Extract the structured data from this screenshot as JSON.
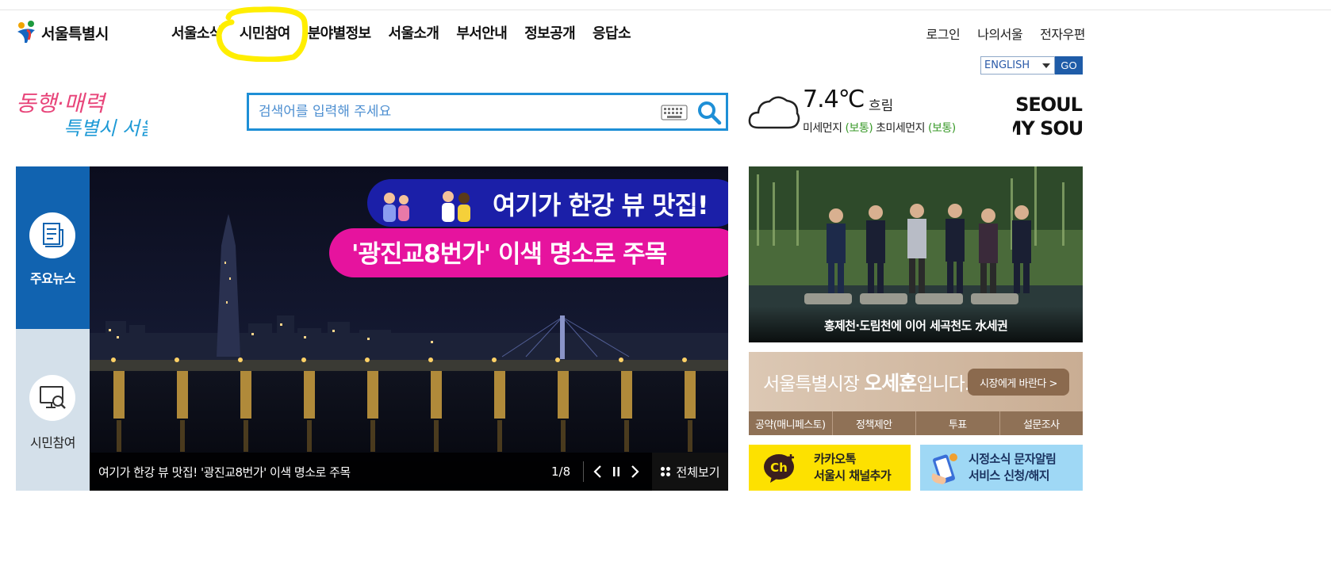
{
  "header": {
    "logo_text": "서울특별시",
    "nav": [
      "서울소식",
      "시민참여",
      "분야별정보",
      "서울소개",
      "부서안내",
      "정보공개",
      "응답소"
    ],
    "util": [
      "로그인",
      "나의서울",
      "전자우편"
    ],
    "language": {
      "selected": "ENGLISH",
      "go_label": "GO"
    },
    "slogan_line1": "동행·매력",
    "slogan_line2": "특별시 서울"
  },
  "search": {
    "placeholder": "검색어를 입력해 주세요"
  },
  "weather": {
    "temperature": "7.4℃",
    "condition": "흐림",
    "fine_dust_label": "미세먼지",
    "fine_dust_value": "(보통)",
    "ultra_dust_label": "초미세먼지",
    "ultra_dust_value": "(보통)"
  },
  "brand": {
    "line1": "SEOUL",
    "line2": "MY SOUL"
  },
  "side_tabs": [
    {
      "label": "주요뉴스",
      "active": true
    },
    {
      "label": "시민참여",
      "active": false
    }
  ],
  "slide": {
    "banner_line1": "여기가 한강 뷰 맛집!",
    "banner_line2": "'광진교8번가' 이색 명소로 주목",
    "caption": "여기가 한강 뷰 맛집! '광진교8번가' 이색 명소로 주목",
    "counter": "1/8",
    "view_all": "전체보기"
  },
  "news_photo": {
    "caption": "홍제천·도림천에 이어 세곡천도 水세권"
  },
  "mayor": {
    "title_prefix": "서울특별시장 ",
    "title_name": "오세훈",
    "title_suffix": "입니다.",
    "button": "시장에게 바란다 >",
    "tabs": [
      "공약(매니페스토)",
      "정책제안",
      "투표",
      "설문조사"
    ]
  },
  "kakao": {
    "line1": "카카오톡",
    "line2": "서울시 채널추가",
    "icon_text": "Ch"
  },
  "sms_service": {
    "line1": "시정소식 문자알림",
    "line2": "서비스 신청/해지"
  },
  "colors": {
    "accent_blue": "#1163b0",
    "search_border": "#1e8fd6",
    "highlight_yellow": "#ffee00",
    "kakao_yellow": "#fde100"
  }
}
